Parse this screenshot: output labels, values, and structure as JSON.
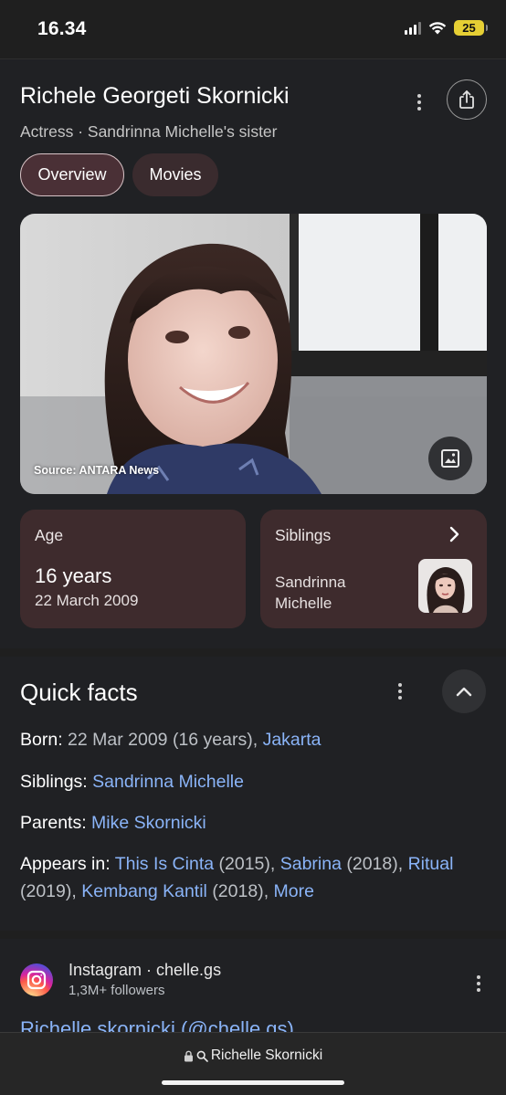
{
  "status_bar": {
    "time": "16.34",
    "battery": "25"
  },
  "knowledge_panel": {
    "title": "Richele Georgeti Skornicki",
    "subtitle": "Actress · Sandrinna Michelle's sister",
    "tabs": [
      {
        "label": "Overview",
        "selected": true
      },
      {
        "label": "Movies",
        "selected": false
      }
    ],
    "image_source": "Source: ANTARA News",
    "age_card": {
      "label": "Age",
      "value": "16 years",
      "date": "22 March 2009"
    },
    "siblings_card": {
      "label": "Siblings",
      "name": "Sandrinna Michelle"
    }
  },
  "quick_facts": {
    "title": "Quick facts",
    "born": {
      "key": "Born",
      "text": " 22 Mar 2009 (16 years), ",
      "link": "Jakarta"
    },
    "siblings": {
      "key": "Siblings",
      "link": "Sandrinna Michelle"
    },
    "parents": {
      "key": "Parents",
      "link": "Mike Skornicki"
    },
    "appears_in": {
      "key": "Appears in",
      "items": [
        {
          "title": "This Is Cinta",
          "year": "(2015)"
        },
        {
          "title": "Sabrina",
          "year": "(2018)"
        },
        {
          "title": "Ritual",
          "year": "(2019)"
        },
        {
          "title": "Kembang Kantil",
          "year": "(2018)"
        }
      ],
      "more": "More"
    }
  },
  "instagram_result": {
    "site": "Instagram · chelle.gs",
    "followers": "1,3M+ followers",
    "link_title": "Richelle skornicki (@chelle.gs)"
  },
  "bottom_bar": {
    "url_text": "Richelle Skornicki"
  },
  "colors": {
    "link": "#8ab4f8",
    "card": "#3e2b2d",
    "chip_selected": "#4a3036",
    "background": "#202124"
  }
}
